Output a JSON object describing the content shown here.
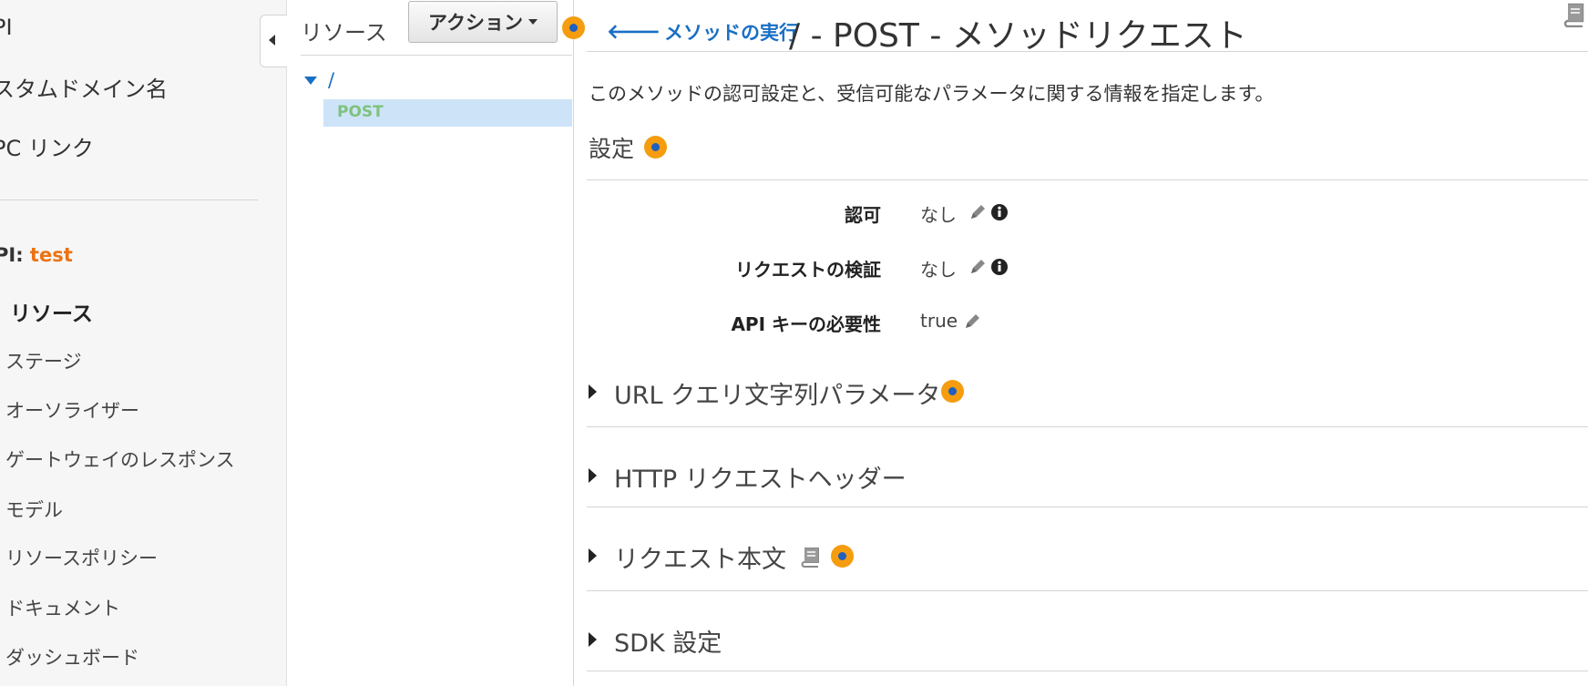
{
  "nav": {
    "top_items": [
      "PI",
      "スタムドメイン名",
      "PC リンク"
    ],
    "api_prefix": "PI:",
    "api_name": "test",
    "sub_items": [
      "リソース",
      "ステージ",
      "オーソライザー",
      "ゲートウェイのレスポンス",
      "モデル",
      "リソースポリシー",
      "ドキュメント",
      "ダッシュボード"
    ]
  },
  "tree": {
    "title": "リソース",
    "actions_label": "アクション",
    "root": "/",
    "method": "POST"
  },
  "main": {
    "back_label": "メソッドの実行",
    "title": "/ - POST - メソッドリクエスト",
    "description": "このメソッドの認可設定と、受信可能なパラメータに関する情報を指定します。",
    "settings_heading": "設定",
    "settings": [
      {
        "label": "認可",
        "value": "なし"
      },
      {
        "label": "リクエストの検証",
        "value": "なし"
      },
      {
        "label": "API キーの必要性",
        "value": "true"
      }
    ],
    "sections": [
      "URL クエリ文字列パラメータ",
      "HTTP リクエストヘッダー",
      "リクエスト本文",
      "SDK 設定"
    ]
  },
  "colors": {
    "accent_link": "#1a6fc4",
    "api_name": "#ec7211",
    "help_dot": "#f59c0f",
    "selected_row": "#cde4f8",
    "method_text": "#7fc27f"
  },
  "icons": [
    "collapse-arrow-icon",
    "chevron-down-icon",
    "back-arrow-icon",
    "book-icon",
    "pencil-icon",
    "info-icon",
    "expand-triangle-icon",
    "help-icon"
  ]
}
